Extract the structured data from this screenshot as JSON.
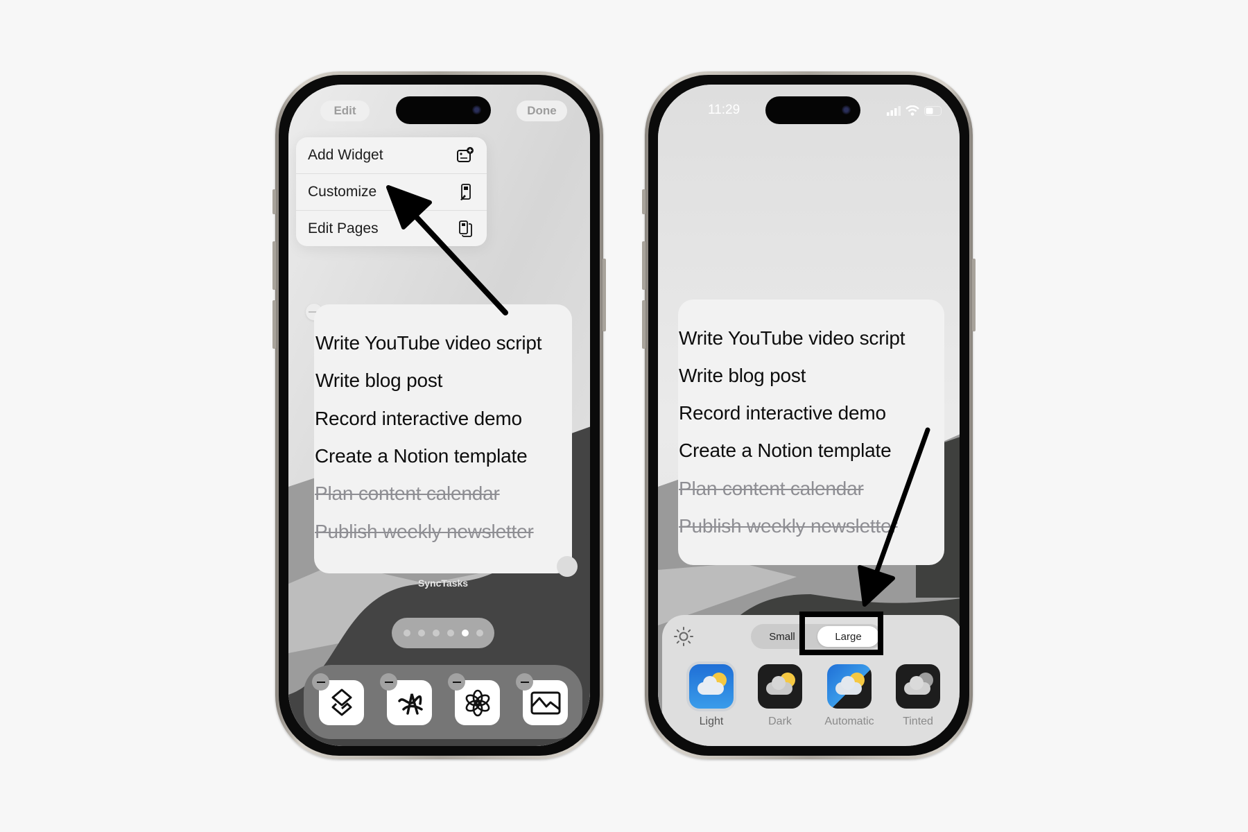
{
  "left_phone": {
    "top_bar": {
      "edit_label": "Edit",
      "done_label": "Done"
    },
    "menu": {
      "items": [
        {
          "label": "Add Widget",
          "icon": "add-widget-icon"
        },
        {
          "label": "Customize",
          "icon": "customize-icon"
        },
        {
          "label": "Edit Pages",
          "icon": "edit-pages-icon"
        }
      ]
    },
    "widget": {
      "app_name": "SyncTasks",
      "tasks": [
        {
          "text": "Write YouTube video script",
          "done": false
        },
        {
          "text": "Write blog post",
          "done": false
        },
        {
          "text": "Record interactive demo",
          "done": false
        },
        {
          "text": "Create a Notion template",
          "done": false
        },
        {
          "text": "Plan content calendar",
          "done": true
        },
        {
          "text": "Publish weekly newsletter",
          "done": true
        }
      ]
    },
    "page_dots": {
      "count": 6,
      "active_index": 4
    },
    "dock": {
      "apps": [
        {
          "name": "layers-app",
          "icon": "layers-icon"
        },
        {
          "name": "scribble-app",
          "icon": "scribble-icon"
        },
        {
          "name": "chatgpt-app",
          "icon": "chatgpt-icon"
        },
        {
          "name": "photos-app",
          "icon": "image-icon"
        }
      ]
    }
  },
  "right_phone": {
    "status_bar": {
      "time": "11:29"
    },
    "widget": {
      "tasks": [
        {
          "text": "Write YouTube video script",
          "done": false
        },
        {
          "text": "Write blog post",
          "done": false
        },
        {
          "text": "Record interactive demo",
          "done": false
        },
        {
          "text": "Create a Notion template",
          "done": false
        },
        {
          "text": "Plan content calendar",
          "done": true
        },
        {
          "text": "Publish weekly newsletter",
          "done": true
        }
      ]
    },
    "customize_panel": {
      "brightness_icon": "sun-icon",
      "size_options": [
        "Small",
        "Large"
      ],
      "selected_size": "Large",
      "themes": [
        {
          "label": "Light",
          "selected": true
        },
        {
          "label": "Dark",
          "selected": false
        },
        {
          "label": "Automatic",
          "selected": false
        },
        {
          "label": "Tinted",
          "selected": false
        }
      ]
    }
  }
}
